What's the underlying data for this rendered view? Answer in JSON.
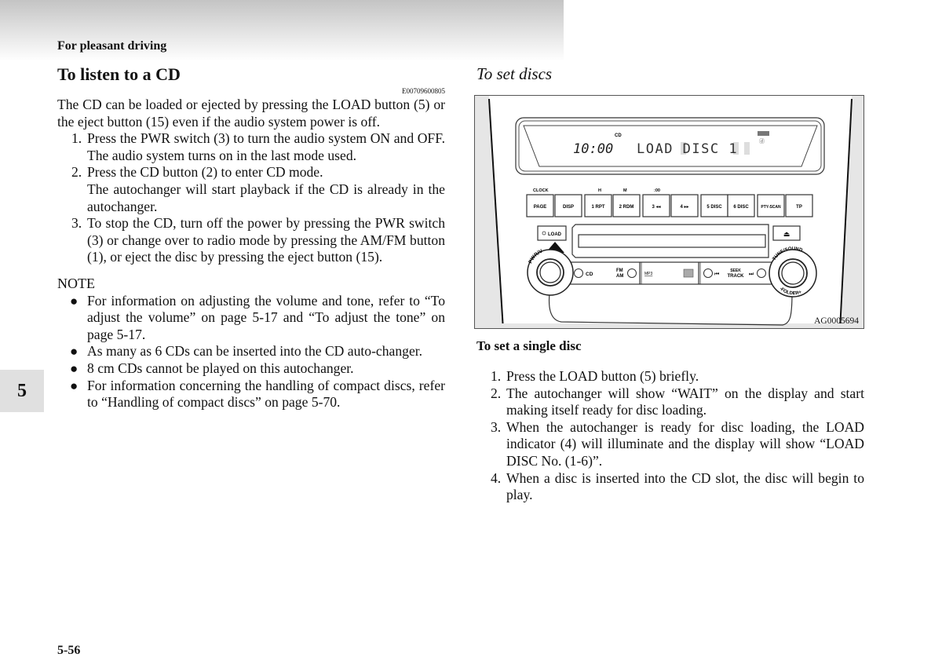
{
  "header": {
    "section": "For pleasant driving"
  },
  "left": {
    "title": "To listen to a CD",
    "code": "E00709600805",
    "intro": "The CD can be loaded or ejected by pressing the LOAD button (5) or the eject button (15) even if the audio system power is off.",
    "steps": [
      {
        "num": "1.",
        "text": "Press the PWR switch (3) to turn the audio system ON and OFF. The audio system turns on in the last mode used.",
        "sub": ""
      },
      {
        "num": "2.",
        "text": "Press the CD button (2) to enter CD mode.",
        "sub": "The autochanger will start playback if the CD is already in the autochanger."
      },
      {
        "num": "3.",
        "text": "To stop the CD, turn off the power by pressing the PWR switch (3) or change over to radio mode by pressing the AM/FM button (1), or eject the disc by pressing the eject button (15).",
        "sub": ""
      }
    ],
    "note_title": "NOTE",
    "notes": [
      "For information on adjusting the volume and tone, refer to “To adjust the volume” on page 5-17 and “To adjust the tone” on page 5-17.",
      "As many as 6 CDs can be inserted into the CD auto-changer.",
      "8 cm CDs cannot be played on this autochanger.",
      "For information concerning the handling of compact discs, refer to “Handling of compact discs” on page 5-70."
    ],
    "bullet_glyph": "●"
  },
  "chapter_tab": "5",
  "page_number": "5-56",
  "right": {
    "title": "To set discs",
    "figure": {
      "code": "AG0005694",
      "display": {
        "mode": "CD",
        "clock": "10:00",
        "message": "LOAD DISC 1",
        "indicator": "DISC"
      },
      "preset_labels": {
        "clock": "CLOCK",
        "h": "H",
        "m": "M",
        "zero": ":00"
      },
      "buttons": [
        "PAGE",
        "DISP",
        "1 RPT",
        "2 RDM",
        "3 ◂◂",
        "4 ▸▸",
        "5 DISC",
        "6 DISC",
        "PTY-SCAN",
        "TP"
      ],
      "load_label": "LOAD",
      "pwr_label": "PWR/V",
      "tune_label": "TUNE/SOUND",
      "folder_label": "-FOLDER+",
      "cd_label": "CD",
      "fm_label": "FM",
      "am_label": "AM",
      "mp3_label": "MP3",
      "seek_label": "SEEK",
      "track_label": "TRACK",
      "prev_glyph": "⏮",
      "next_glyph": "⏭",
      "eject_glyph": "⏏"
    },
    "subtitle": "To set a single disc",
    "steps": [
      {
        "num": "1.",
        "text": "Press the LOAD button (5) briefly."
      },
      {
        "num": "2.",
        "text": "The autochanger will show “WAIT” on the display and start making itself ready for disc loading."
      },
      {
        "num": "3.",
        "text": "When the autochanger is ready for disc loading, the LOAD indicator (4) will illuminate and the display will show “LOAD DISC No. (1-6)”."
      },
      {
        "num": "4.",
        "text": "When a disc is inserted into the CD slot, the disc will begin to play."
      }
    ]
  }
}
